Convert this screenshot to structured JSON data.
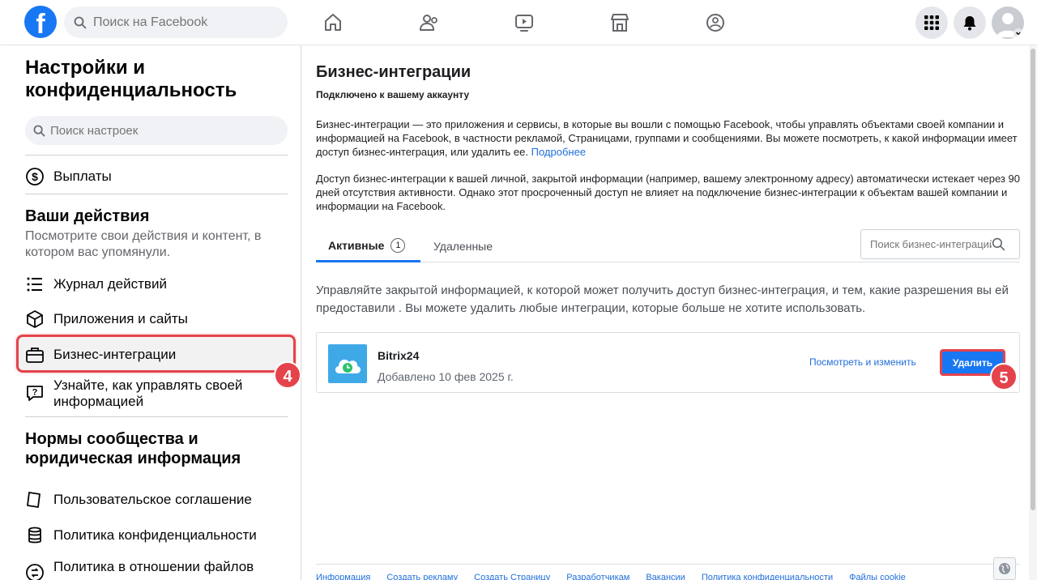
{
  "topbar": {
    "logo": "f",
    "search_placeholder": "Поиск на Facebook",
    "nav_icons": [
      "home-icon",
      "friends-icon",
      "watch-icon",
      "marketplace-icon",
      "groups-icon"
    ]
  },
  "sidebar": {
    "title": "Настройки и конфиденциальность",
    "search_placeholder": "Поиск настроек",
    "payments": "Выплаты",
    "your_activity": {
      "title": "Ваши действия",
      "subtitle": "Посмотрите свои действия и контент, в котором вас упомянули.",
      "items": [
        {
          "label": "Журнал действий",
          "icon": "list-icon"
        },
        {
          "label": "Приложения и сайты",
          "icon": "cube-icon"
        },
        {
          "label": "Бизнес-интеграции",
          "icon": "briefcase-icon"
        },
        {
          "label": "Узнайте, как управлять своей информацией",
          "icon": "help-icon"
        }
      ]
    },
    "community": {
      "title": "Нормы сообщества и юридическая информация",
      "items": [
        {
          "label": "Пользовательское соглашение",
          "icon": "document-icon"
        },
        {
          "label": "Политика конфиденциальности",
          "icon": "database-icon"
        },
        {
          "label": "Политика в отношении файлов",
          "icon": "cookie-icon"
        }
      ]
    }
  },
  "annotations": {
    "step4": "4",
    "step5": "5"
  },
  "main": {
    "title": "Бизнес-интеграции",
    "subtitle": "Подключено к вашему аккаунту",
    "para1": "Бизнес-интеграции — это приложения и сервисы, в которые вы вошли с помощью Facebook, чтобы управлять объектами своей компании и информацией на Facebook, в частности рекламой, Страницами, группами и сообщениями. Вы можете посмотреть, к какой информации имеет доступ бизнес-интеграция, или удалить ее.",
    "learn_more": "Подробнее",
    "para2": "Доступ бизнес-интеграции к вашей личной, закрытой информации (например, вашему электронному адресу) автоматически истекает через 90 дней отсутствия активности. Однако этот просроченный доступ не влияет на подключение бизнес-интеграции к объектам вашей компании и информации на Facebook.",
    "tabs": {
      "active": "Активные",
      "active_count": "1",
      "deleted": "Удаленные"
    },
    "integration_search_placeholder": "Поиск бизнес-интеграций",
    "description": "Управляйте закрытой информацией, к которой может получить доступ бизнес-интеграция, и тем, какие разрешения вы ей предоставили . Вы можете удалить любые интеграции, которые больше не хотите использовать.",
    "integration": {
      "name": "Bitrix24",
      "added": "Добавлено 10 фев 2025 г.",
      "view_link": "Посмотреть и изменить",
      "delete_button": "Удалить"
    },
    "footer_links": [
      "Информация",
      "Создать рекламу",
      "Создать Страницу",
      "Разработчикам",
      "Вакансии",
      "Политика конфиденциальности",
      "Файлы cookie"
    ]
  },
  "colors": {
    "accent": "#1877f2",
    "highlight": "#e4434b",
    "link": "#216fdb"
  }
}
